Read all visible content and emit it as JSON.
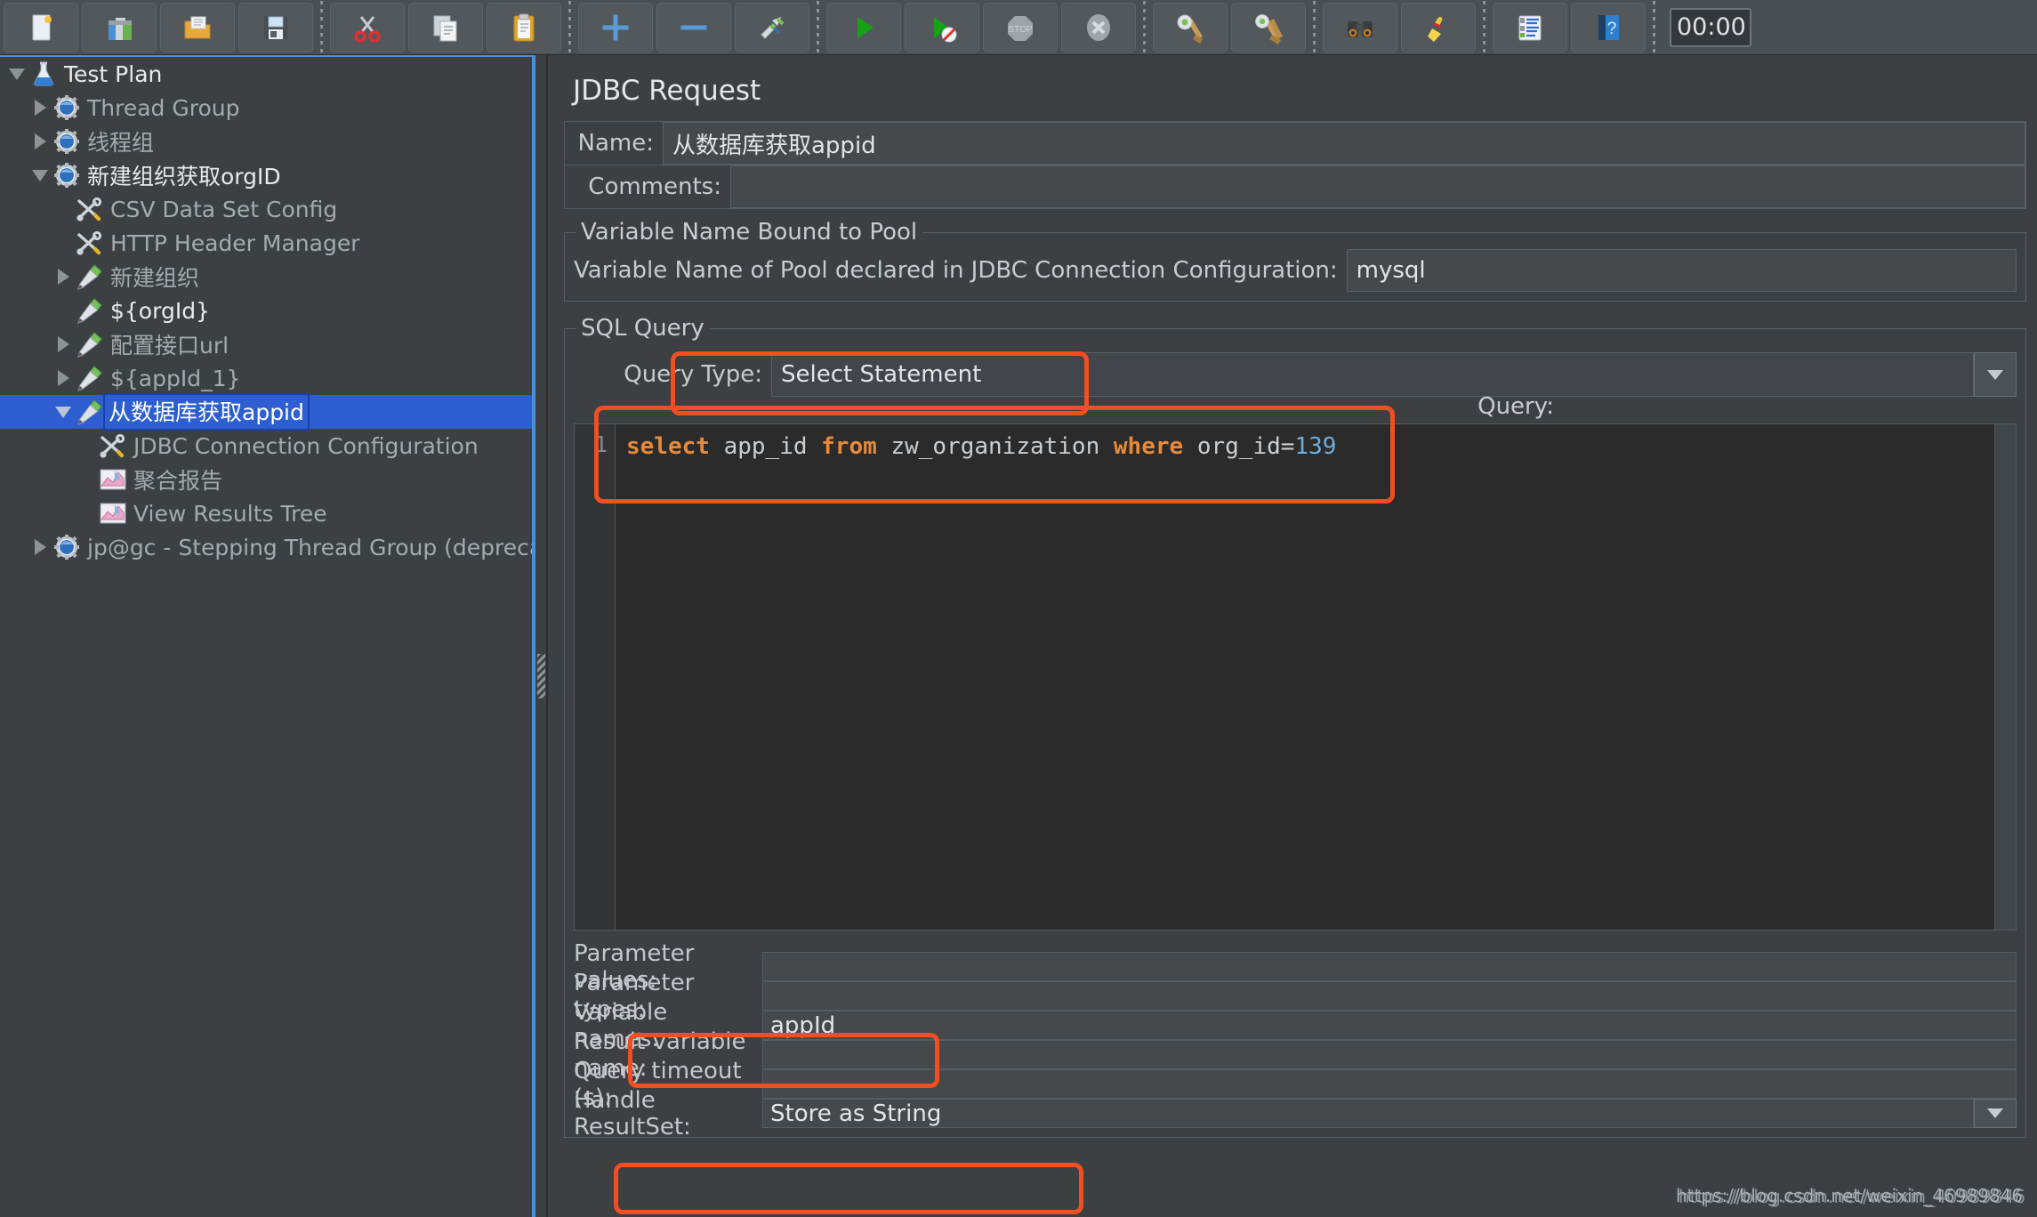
{
  "toolbar": {
    "buttons": [
      {
        "name": "new-test-plan",
        "icon": "new-document-icon"
      },
      {
        "name": "templates",
        "icon": "templates-folder-icon"
      },
      {
        "name": "open",
        "icon": "open-folder-icon"
      },
      {
        "name": "save",
        "icon": "save-floppy-icon"
      },
      {
        "name": "cut",
        "icon": "cut-scissors-icon"
      },
      {
        "name": "copy",
        "icon": "copy-pages-icon"
      },
      {
        "name": "paste",
        "icon": "paste-clipboard-icon"
      },
      {
        "name": "expand-all",
        "icon": "plus-icon"
      },
      {
        "name": "collapse-all",
        "icon": "minus-icon"
      },
      {
        "name": "toggle",
        "icon": "toggle-pencils-icon"
      },
      {
        "name": "start",
        "icon": "start-play-icon"
      },
      {
        "name": "start-no-timers",
        "icon": "start-no-pauses-icon"
      },
      {
        "name": "stop",
        "icon": "stop-sign-icon"
      },
      {
        "name": "shutdown",
        "icon": "shutdown-x-icon"
      },
      {
        "name": "clear",
        "icon": "clear-broom-icon"
      },
      {
        "name": "clear-all",
        "icon": "clear-all-broom-icon"
      },
      {
        "name": "search",
        "icon": "binoculars-icon"
      },
      {
        "name": "reset-search",
        "icon": "reset-search-broom-icon"
      },
      {
        "name": "function-helper",
        "icon": "function-helper-icon"
      },
      {
        "name": "help",
        "icon": "help-book-icon"
      }
    ],
    "timer": "00:00"
  },
  "tree": {
    "items": [
      {
        "label": "Test Plan",
        "icon": "test-plan-flask-icon",
        "indent": 0,
        "toggle": "down",
        "bright": true,
        "selected": false
      },
      {
        "label": "Thread Group",
        "icon": "thread-group-gear-icon",
        "indent": 1,
        "toggle": "right",
        "bright": false,
        "selected": false
      },
      {
        "label": "线程组",
        "icon": "thread-group-gear-icon",
        "indent": 1,
        "toggle": "right",
        "bright": false,
        "selected": false
      },
      {
        "label": "新建组织获取orgID",
        "icon": "thread-group-gear-icon",
        "indent": 1,
        "toggle": "down",
        "bright": true,
        "selected": false
      },
      {
        "label": "CSV Data Set Config",
        "icon": "config-element-icon",
        "indent": 2,
        "toggle": "none",
        "bright": false,
        "selected": false
      },
      {
        "label": "HTTP Header Manager",
        "icon": "config-element-icon",
        "indent": 2,
        "toggle": "none",
        "bright": false,
        "selected": false
      },
      {
        "label": "新建组织",
        "icon": "sampler-pencil-icon",
        "indent": 2,
        "toggle": "right",
        "bright": false,
        "selected": false
      },
      {
        "label": "${orgId}",
        "icon": "sampler-pencil-icon",
        "indent": 2,
        "toggle": "none",
        "bright": true,
        "selected": false
      },
      {
        "label": "配置接口url",
        "icon": "sampler-pencil-icon",
        "indent": 2,
        "toggle": "right",
        "bright": false,
        "selected": false
      },
      {
        "label": "${appId_1}",
        "icon": "sampler-pencil-icon",
        "indent": 2,
        "toggle": "right",
        "bright": false,
        "selected": false
      },
      {
        "label": "从数据库获取appid",
        "icon": "sampler-pencil-icon",
        "indent": 2,
        "toggle": "down",
        "bright": true,
        "selected": true
      },
      {
        "label": "JDBC Connection Configuration",
        "icon": "config-element-icon",
        "indent": 3,
        "toggle": "none",
        "bright": false,
        "selected": false
      },
      {
        "label": "聚合报告",
        "icon": "listener-chart-icon",
        "indent": 3,
        "toggle": "none",
        "bright": false,
        "selected": false
      },
      {
        "label": "View Results Tree",
        "icon": "listener-chart-icon",
        "indent": 3,
        "toggle": "none",
        "bright": false,
        "selected": false
      },
      {
        "label": "jp@gc - Stepping Thread Group (deprecated)",
        "icon": "thread-group-gear-icon",
        "indent": 1,
        "toggle": "right",
        "bright": false,
        "selected": false
      }
    ]
  },
  "main": {
    "title": "JDBC Request",
    "name_label": "Name:",
    "name_value": "从数据库获取appid",
    "comments_label": "Comments:",
    "comments_value": "",
    "pool_group_title": "Variable Name Bound to Pool",
    "pool_label": "Variable Name of Pool declared in JDBC Connection Configuration:",
    "pool_value": "mysql",
    "sql_group_title": "SQL Query",
    "query_type_label": "Query Type:",
    "query_type_value": "Select Statement",
    "query_caption": "Query:",
    "sql": {
      "line_number": "1",
      "tokens": [
        {
          "t": "select",
          "k": "kw"
        },
        {
          "t": " ",
          "k": "plain"
        },
        {
          "t": "app_id",
          "k": "ident"
        },
        {
          "t": " ",
          "k": "plain"
        },
        {
          "t": "from",
          "k": "kw"
        },
        {
          "t": " ",
          "k": "plain"
        },
        {
          "t": "zw_organization",
          "k": "ident"
        },
        {
          "t": " ",
          "k": "plain"
        },
        {
          "t": "where",
          "k": "kw"
        },
        {
          "t": " ",
          "k": "plain"
        },
        {
          "t": "org_id=",
          "k": "ident"
        },
        {
          "t": "139",
          "k": "num"
        }
      ],
      "text": "select app_id from zw_organization where org_id=139"
    },
    "fields": [
      {
        "label": "Parameter values:",
        "value": "",
        "combo": false
      },
      {
        "label": "Parameter types:",
        "value": "",
        "combo": false
      },
      {
        "label": "Variable names:",
        "value": "appId",
        "combo": false
      },
      {
        "label": "Result variable name:",
        "value": "",
        "combo": false
      },
      {
        "label": "Query timeout (s):",
        "value": "",
        "combo": false
      },
      {
        "label": "Handle ResultSet:",
        "value": "Store as String",
        "combo": true
      }
    ]
  },
  "watermark": {
    "line1": "https://blog.csdn.net/weixin_46989846",
    "line2": "https://blog.csdn.net/weixin_40989846"
  },
  "colors": {
    "accent_blue": "#2d5fd0",
    "annotation_red": "#f04e23",
    "panel_bg": "#3c4043",
    "toolbar_bg": "#4a4f53",
    "editor_bg": "#2b2b2b",
    "keyword_orange": "#e8893a",
    "number_blue": "#6eaddb"
  }
}
